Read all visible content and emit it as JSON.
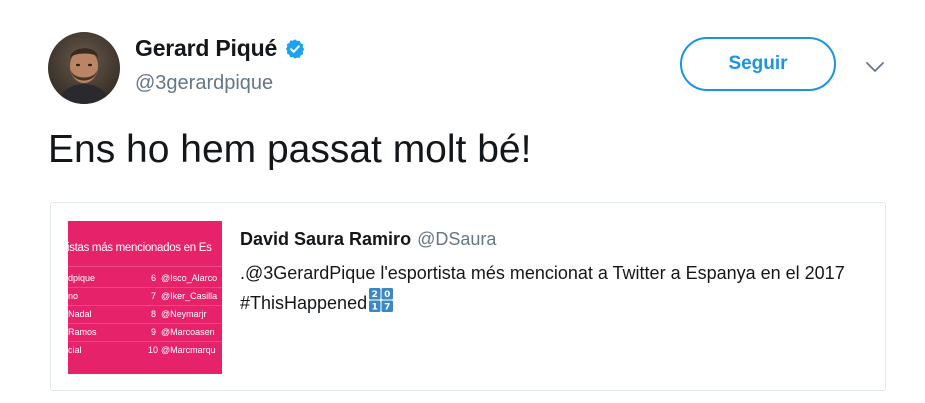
{
  "header": {
    "display_name": "Gerard Piqué",
    "handle": "@3gerardpique",
    "follow_label": "Seguir"
  },
  "tweet": {
    "text": "Ens ho hem passat molt bé!"
  },
  "quoted": {
    "author_name": "David Saura Ramiro",
    "author_handle": "@DSaura",
    "text": ".@3GerardPique l'esportista més mencionat a Twitter a Espanya en el 2017 #ThisHappened",
    "media": {
      "heading": "tistas más mencionados en Es",
      "rows": [
        {
          "left": "dpique",
          "num": "6",
          "right": "@Isco_Alarco"
        },
        {
          "left": "no",
          "num": "7",
          "right": "@Iker_Casilla"
        },
        {
          "left": "Nadal",
          "num": "8",
          "right": "@Neymarjr"
        },
        {
          "left": "Ramos",
          "num": "9",
          "right": "@Marcoasen"
        },
        {
          "left": "cial",
          "num": "10",
          "right": "@Marcmarqu"
        }
      ]
    }
  },
  "icons": {
    "verified": "verified-badge-icon",
    "chevron": "chevron-down-icon",
    "emoji": "2017-keycap-emoji-icon"
  },
  "colors": {
    "accent": "#1b95e0",
    "media_bg": "#e6236a",
    "secondary_text": "#657786"
  }
}
